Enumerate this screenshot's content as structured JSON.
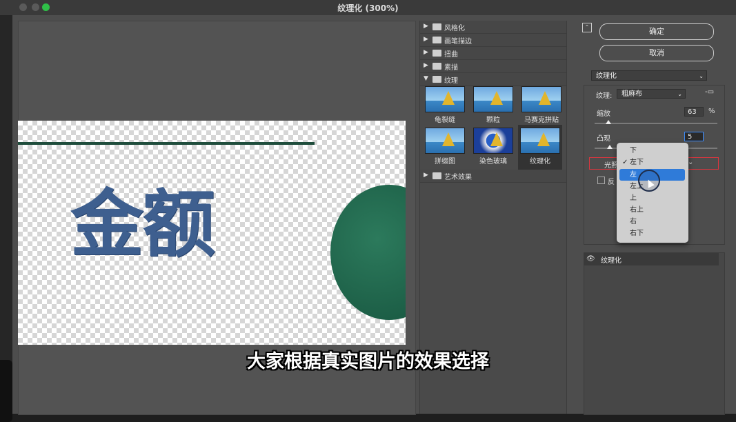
{
  "window": {
    "title": "纹理化 (300%)"
  },
  "preview": {
    "canvas_text": "金额"
  },
  "gallery": {
    "groups": [
      {
        "label": "风格化",
        "expanded": false
      },
      {
        "label": "画笔描边",
        "expanded": false
      },
      {
        "label": "扭曲",
        "expanded": false
      },
      {
        "label": "素描",
        "expanded": false
      },
      {
        "label": "纹理",
        "expanded": true
      },
      {
        "label": "艺术效果",
        "expanded": false
      }
    ],
    "thumbs": [
      "龟裂缝",
      "颗粒",
      "马赛克拼贴",
      "拼缀图",
      "染色玻璃",
      "纹理化"
    ]
  },
  "buttons": {
    "ok": "确定",
    "cancel": "取消"
  },
  "filter_select": "纹理化",
  "settings": {
    "texture_label": "纹理:",
    "texture_value": "粗麻布",
    "scale_label": "缩放",
    "scale_value": "63",
    "scale_unit": "%",
    "scale_level": 0.09,
    "relief_label": "凸现",
    "relief_value": "5",
    "relief_level": 0.1,
    "light_label": "光照",
    "invert_label": "反"
  },
  "light_menu": {
    "items": [
      "下",
      "左下",
      "左",
      "左上",
      "上",
      "右上",
      "右",
      "右下"
    ],
    "checked": "左下",
    "highlighted": "左"
  },
  "layers": {
    "row_label": "纹理化"
  },
  "subtitle": "大家根据真实图片的效果选择"
}
